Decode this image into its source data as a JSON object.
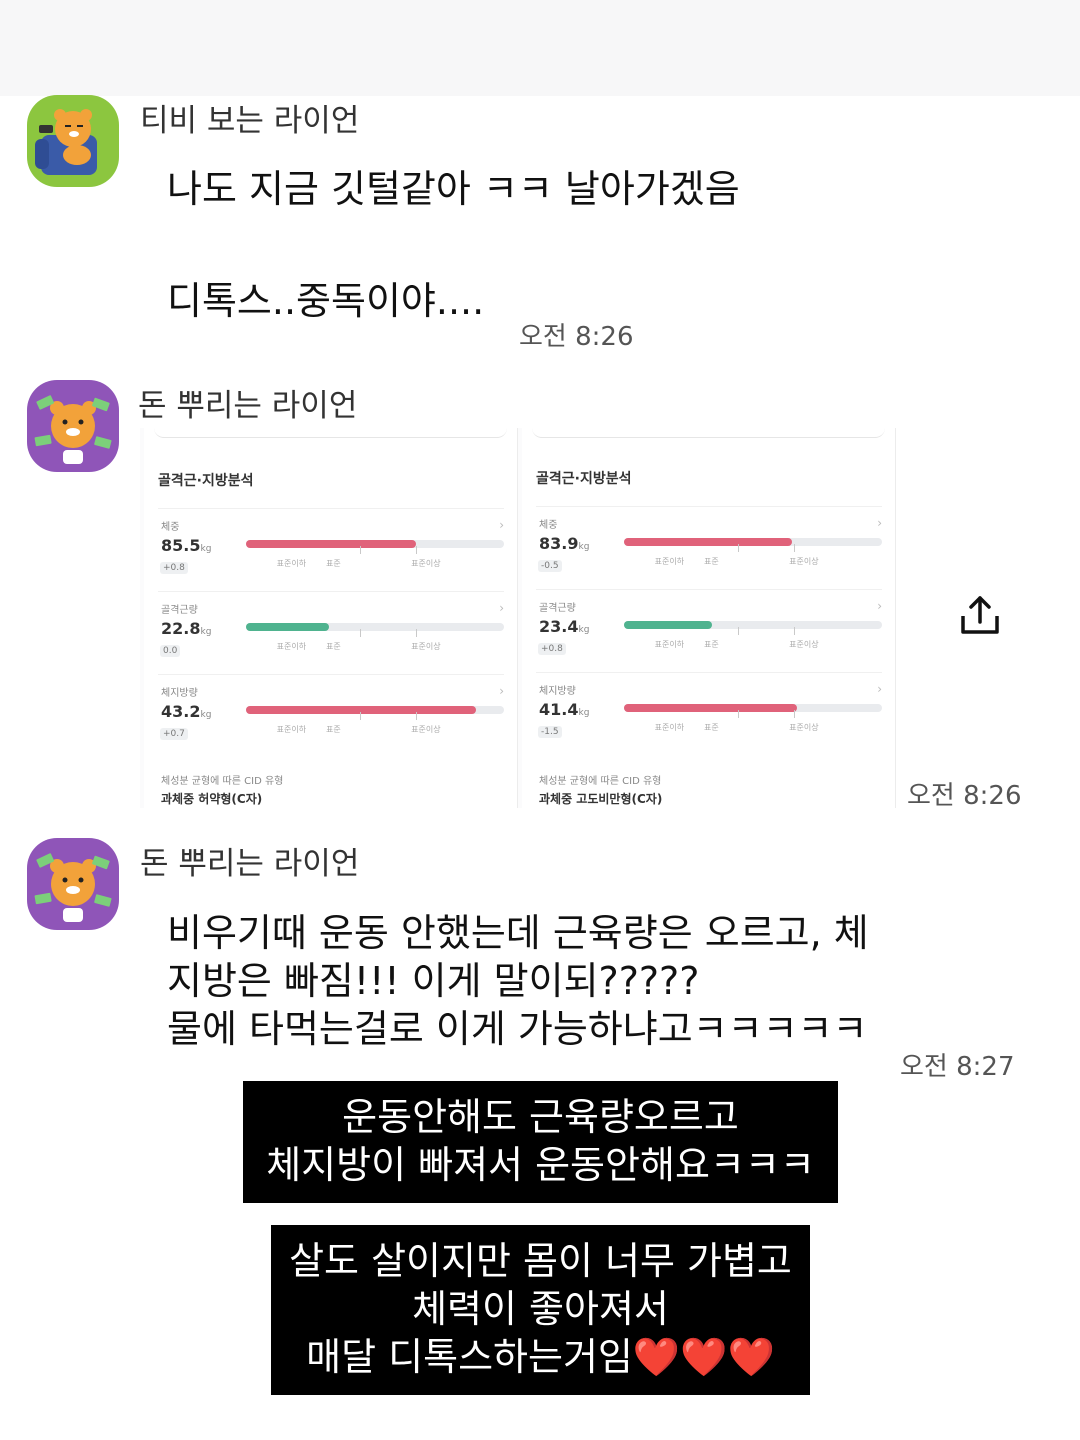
{
  "colors": {
    "fat_bar": "#e0627a",
    "muscle_bar": "#4fb38f",
    "caption_bg": "#000000"
  },
  "messages": [
    {
      "sender": "티비 보는 라이언",
      "avatar_icon": "ryan-tv-avatar-icon",
      "lines": [
        "나도 지금 깃털같아 ㅋㅋ 날아가겠음",
        "디톡스..중독이야...."
      ],
      "time": "오전 8:26"
    },
    {
      "sender": "돈 뿌리는 라이언",
      "avatar_icon": "ryan-money-avatar-icon",
      "time": "오전 8:26",
      "image": {
        "panels": [
          {
            "title": "골격근·지방분석",
            "metrics": [
              {
                "label": "체중",
                "value": "85.5",
                "unit": "kg",
                "delta": "+0.8",
                "bar_fraction": 0.66,
                "bar_color": "fat"
              },
              {
                "label": "골격근량",
                "value": "22.8",
                "unit": "kg",
                "delta": "0.0",
                "bar_fraction": 0.32,
                "bar_color": "muscle"
              },
              {
                "label": "체지방량",
                "value": "43.2",
                "unit": "kg",
                "delta": "+0.7",
                "bar_fraction": 0.89,
                "bar_color": "fat"
              }
            ],
            "scale_labels": [
              "표준이하",
              "표준",
              "표준이상"
            ],
            "cid_label": "체성분 균형에 따른 CID 유형",
            "cid_value": "과체중 허약형(C자)"
          },
          {
            "title": "골격근·지방분석",
            "metrics": [
              {
                "label": "체중",
                "value": "83.9",
                "unit": "kg",
                "delta": "-0.5",
                "bar_fraction": 0.65,
                "bar_color": "fat"
              },
              {
                "label": "골격근량",
                "value": "23.4",
                "unit": "kg",
                "delta": "+0.8",
                "bar_fraction": 0.34,
                "bar_color": "muscle"
              },
              {
                "label": "체지방량",
                "value": "41.4",
                "unit": "kg",
                "delta": "-1.5",
                "bar_fraction": 0.67,
                "bar_color": "fat"
              }
            ],
            "scale_labels": [
              "표준이하",
              "표준",
              "표준이상"
            ],
            "cid_label": "체성분 균형에 따른 CID 유형",
            "cid_value": "과체중 고도비만형(C자)"
          }
        ]
      }
    },
    {
      "sender": "돈 뿌리는 라이언",
      "avatar_icon": "ryan-money-avatar-icon",
      "lines": [
        "비우기때 운동 안했는데 근육량은 오르고, 체",
        "지방은 빠짐!!! 이게 말이되?????",
        "물에 타먹는걸로 이게 가능하냐고ㅋㅋㅋㅋㅋ"
      ],
      "time": "오전 8:27"
    }
  ],
  "share_icon": "share-upload-icon",
  "captions": [
    {
      "lines": [
        "운동안해도 근육량오르고",
        "체지방이 빠져서 운동안해요ㅋㅋㅋ"
      ]
    },
    {
      "lines": [
        "살도 살이지만 몸이 너무 가볍고",
        "체력이 좋아져서",
        "매달 디톡스하는거임❤️❤️❤️"
      ]
    }
  ]
}
